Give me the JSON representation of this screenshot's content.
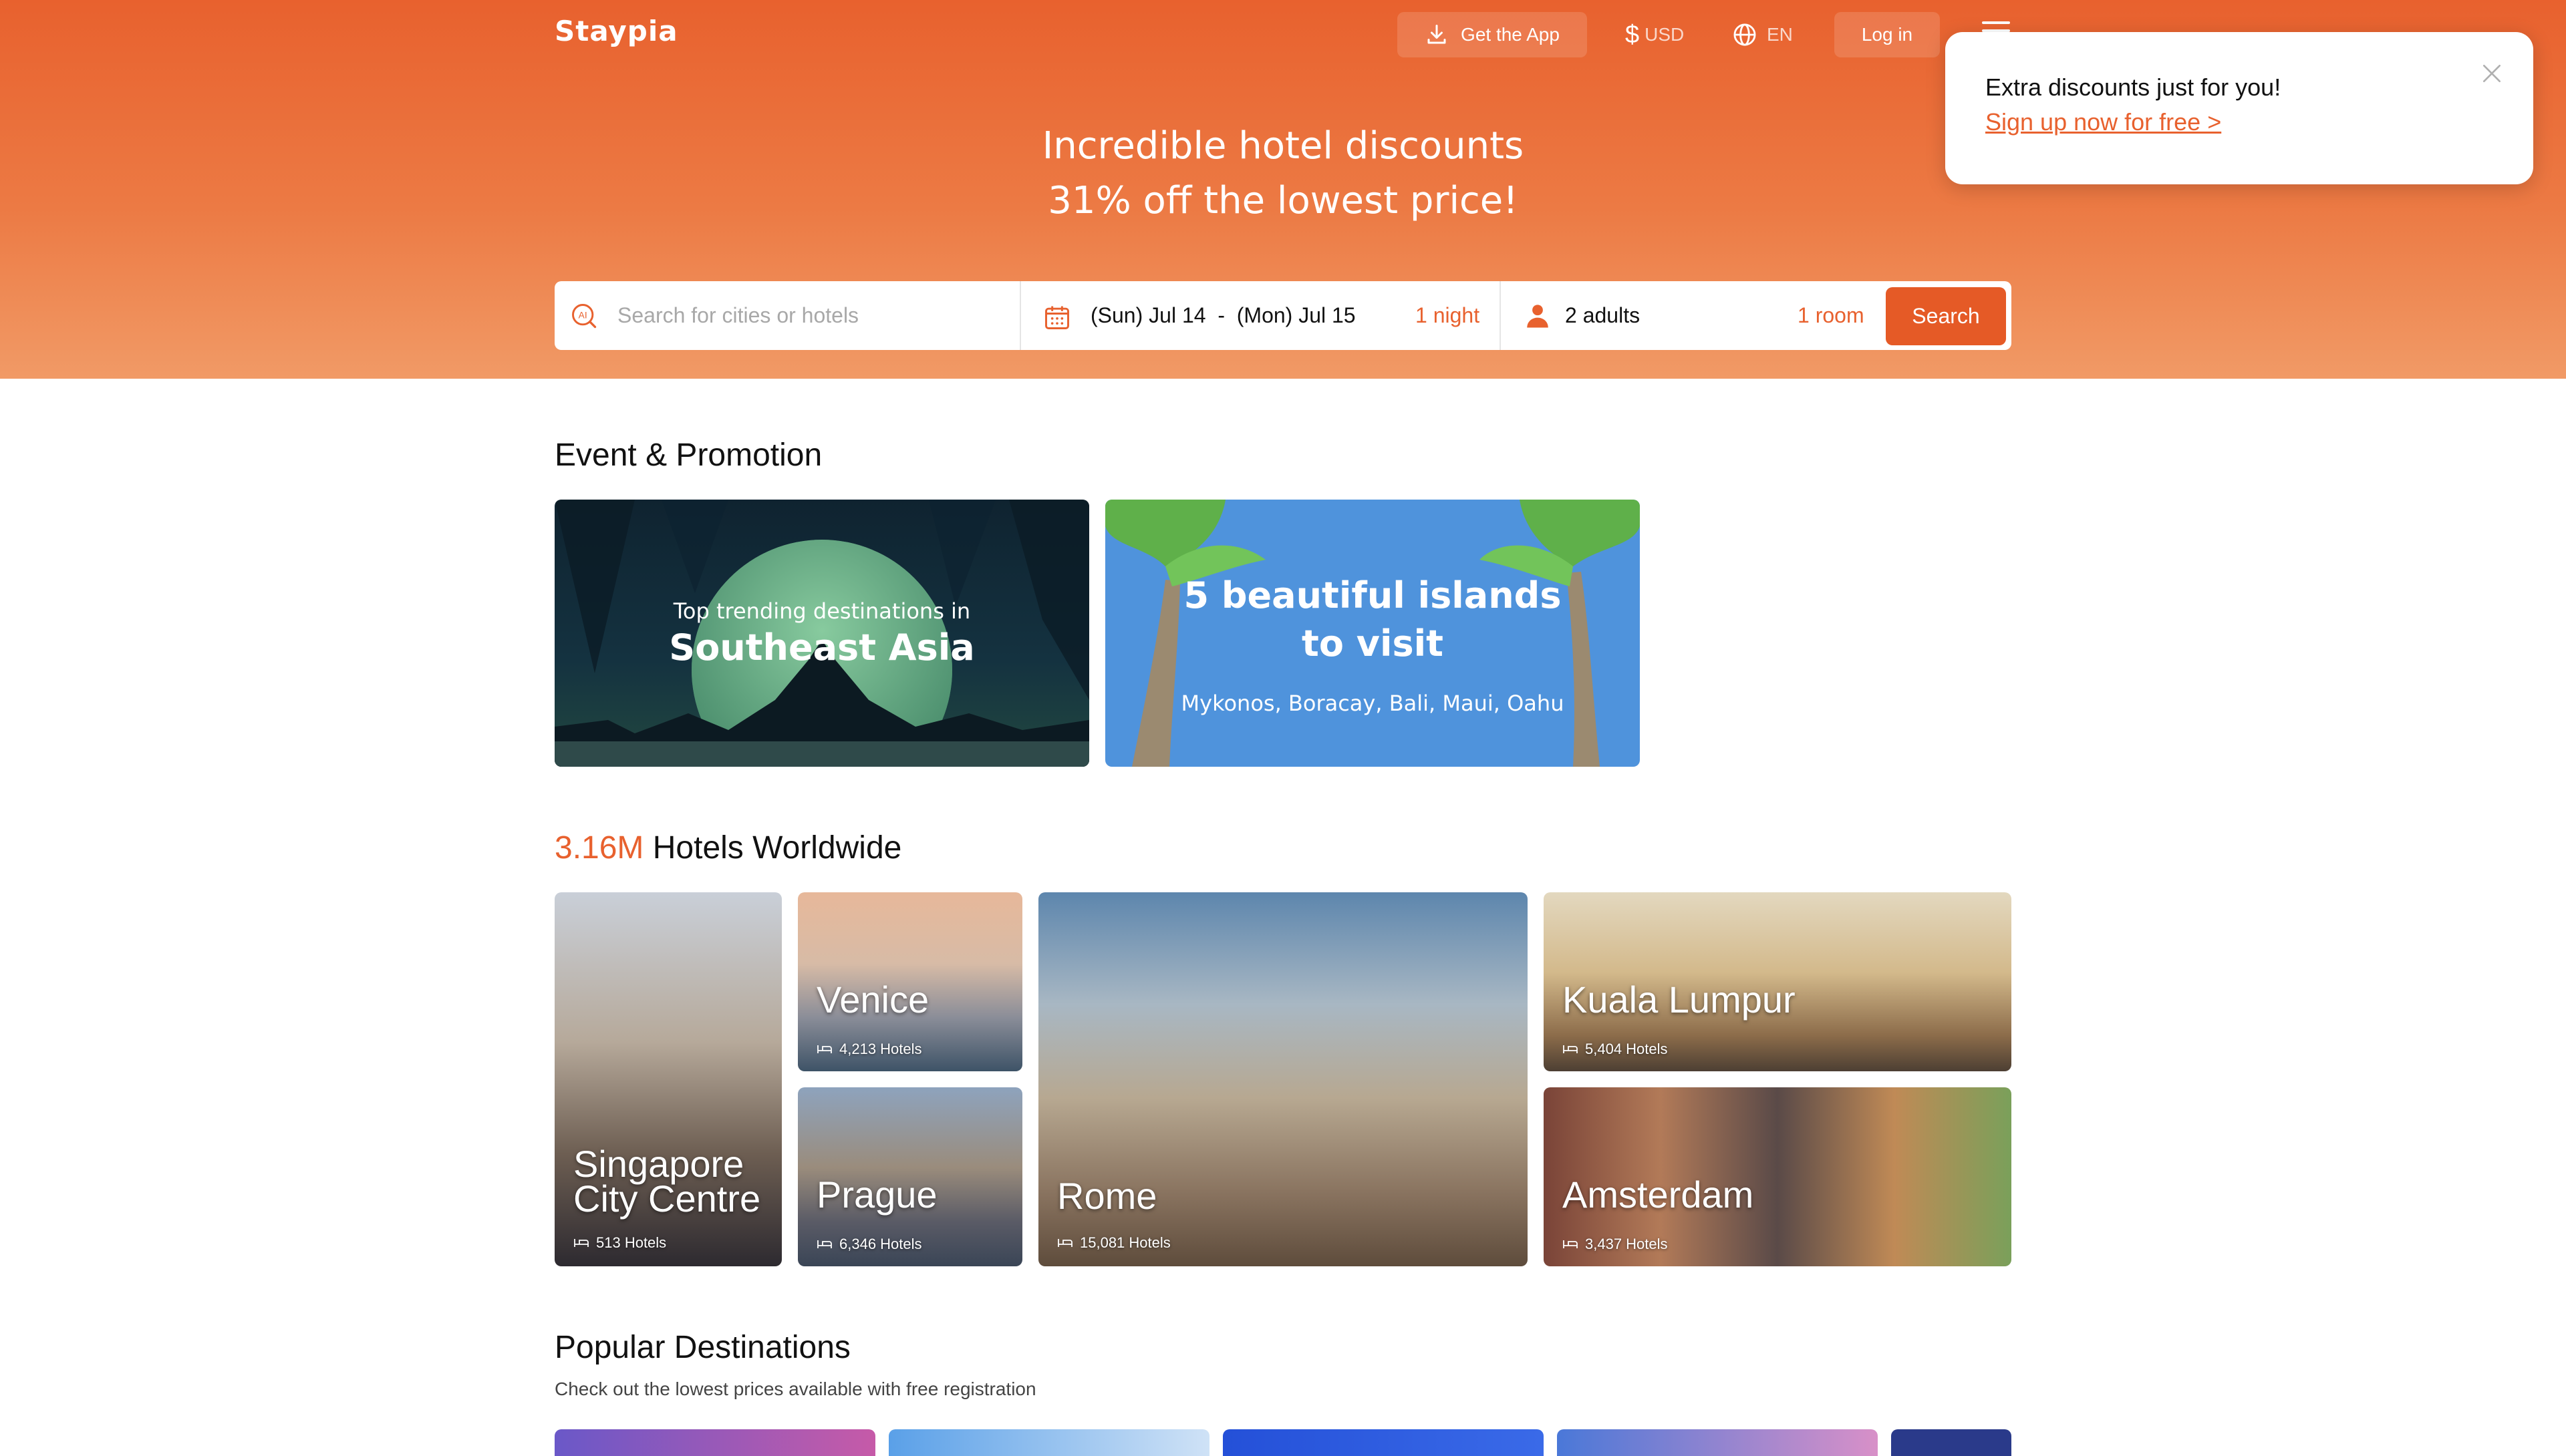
{
  "header": {
    "logo": "Staypia",
    "get_app": "Get the App",
    "currency": "USD",
    "language": "EN",
    "login": "Log in"
  },
  "hero": {
    "line1": "Incredible hotel discounts",
    "line2": "31% off the lowest price!"
  },
  "search": {
    "placeholder": "Search for cities or hotels",
    "dates": "(Sun) Jul 14  -  (Mon) Jul 15",
    "nights": "1 night",
    "guests": "2 adults",
    "rooms": "1 room",
    "button": "Search"
  },
  "popup": {
    "title": "Extra discounts just for you!",
    "link": "Sign up now for free >"
  },
  "promotions": {
    "title": "Event & Promotion",
    "card1": {
      "small": "Top trending destinations in",
      "big": "Southeast Asia"
    },
    "card2": {
      "line1": "5 beautiful islands",
      "line2": "to visit",
      "sub": "Mykonos, Boracay, Bali, Maui, Oahu"
    }
  },
  "hotels": {
    "count": "3.16M",
    "title_rest": " Hotels Worldwide",
    "tiles": [
      {
        "name1": "Singapore",
        "name2": "City Centre",
        "count": "513 Hotels"
      },
      {
        "name1": "Venice",
        "count": "4,213 Hotels"
      },
      {
        "name1": "Prague",
        "count": "6,346 Hotels"
      },
      {
        "name1": "Rome",
        "count": "15,081 Hotels"
      },
      {
        "name1": "Kuala Lumpur",
        "count": "5,404 Hotels"
      },
      {
        "name1": "Amsterdam",
        "count": "3,437 Hotels"
      }
    ]
  },
  "popular": {
    "title": "Popular Destinations",
    "subtitle": "Check out the lowest prices available with free registration"
  },
  "colors": {
    "brand": "#e8612e",
    "hero_top": "#e8612e",
    "hero_bottom": "#f19a66"
  },
  "icons": [
    "download-icon",
    "dollar-icon",
    "globe-icon",
    "hamburger-menu-icon",
    "ai-search-icon",
    "calendar-icon",
    "person-icon",
    "close-icon",
    "bed-icon"
  ]
}
